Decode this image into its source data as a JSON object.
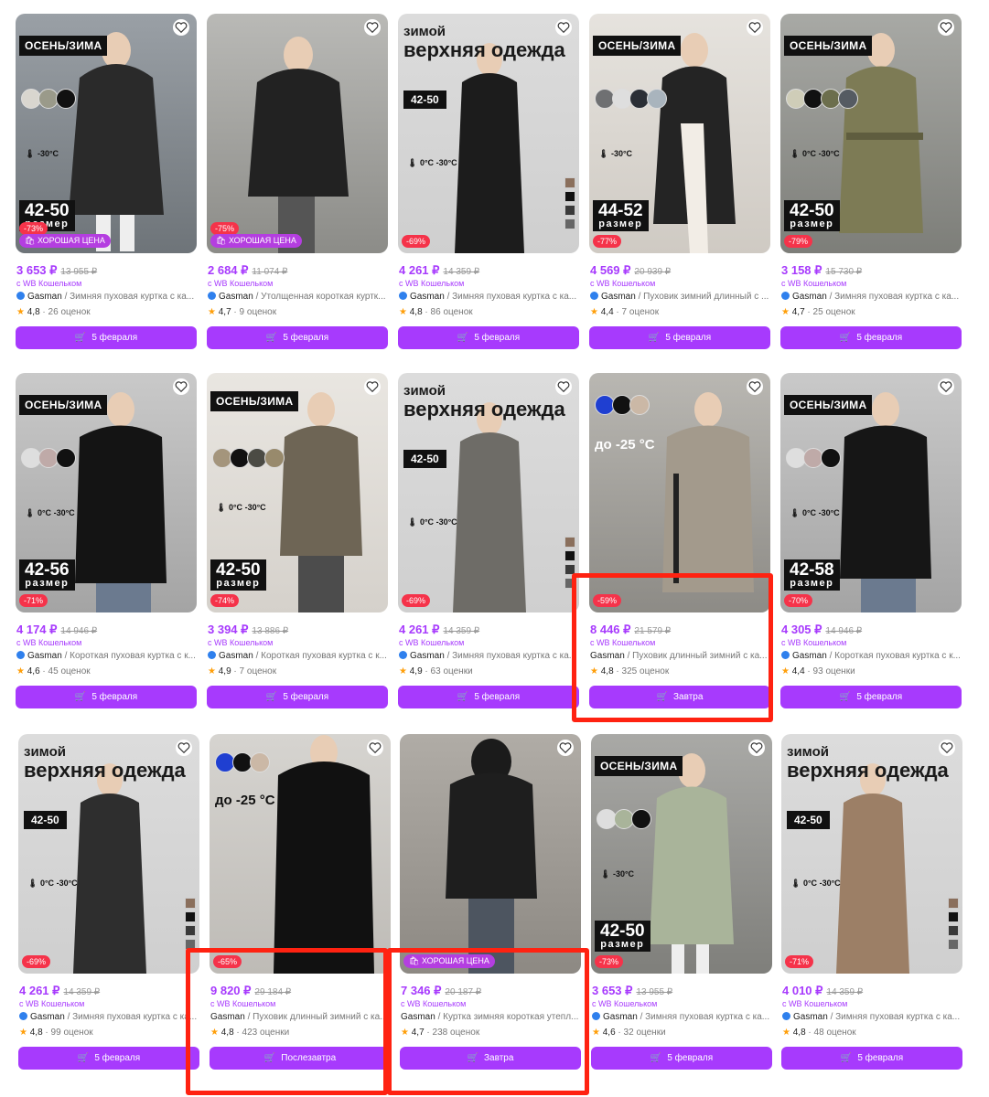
{
  "common": {
    "wallet": "с WB Кошельком",
    "razmer": "размер",
    "heat_plus": "0°C",
    "heat_minus": "-30°C",
    "headline1": "зимой",
    "headline2": "верхняя одежда"
  },
  "row1": [
    {
      "season": "ОСЕНЬ/ЗИМА",
      "size": "42-50",
      "discount": "-73%",
      "good": "ХОРОШАЯ ЦЕНА",
      "temp": "-30°C",
      "price": "3 653 ₽",
      "old": "13 955 ₽",
      "brand": "Gasman",
      "name": "Зимняя пуховая куртка с ка...",
      "rating": "4,8",
      "reviews": "26 оценок",
      "delivery": "5 февраля"
    },
    {
      "discount": "-75%",
      "good": "ХОРОШАЯ ЦЕНА",
      "price": "2 684 ₽",
      "old": "11 074 ₽",
      "brand": "Gasman",
      "name": "Утолщенная короткая куртк...",
      "rating": "4,7",
      "reviews": "9 оценок",
      "delivery": "5 февраля"
    },
    {
      "sizebox": "42-50",
      "discount": "-69%",
      "price": "4 261 ₽",
      "old": "14 359 ₽",
      "brand": "Gasman",
      "name": "Зимняя пуховая куртка с ка...",
      "rating": "4,8",
      "reviews": "86 оценок",
      "delivery": "5 февраля"
    },
    {
      "season": "ОСЕНЬ/ЗИМА",
      "size": "44-52",
      "discount": "-77%",
      "temp": "-30°C",
      "price": "4 569 ₽",
      "old": "20 939 ₽",
      "brand": "Gasman",
      "name": "Пуховик зимний длинный с ...",
      "rating": "4,4",
      "reviews": "7 оценок",
      "delivery": "5 февраля"
    },
    {
      "season": "ОСЕНЬ/ЗИМА",
      "size": "42-50",
      "discount": "-79%",
      "price": "3 158 ₽",
      "old": "15 730 ₽",
      "brand": "Gasman",
      "name": "Зимняя пуховая куртка с ка...",
      "rating": "4,7",
      "reviews": "25 оценок",
      "delivery": "5 февраля"
    }
  ],
  "row2": [
    {
      "season": "ОСЕНЬ/ЗИМА",
      "size": "42-56",
      "discount": "-71%",
      "price": "4 174 ₽",
      "old": "14 946 ₽",
      "brand": "Gasman",
      "name": "Короткая пуховая куртка с к...",
      "rating": "4,6",
      "reviews": "45 оценок",
      "delivery": "5 февраля"
    },
    {
      "season": "ОСЕНЬ/ЗИМА",
      "size": "42-50",
      "discount": "-74%",
      "price": "3 394 ₽",
      "old": "13 886 ₽",
      "brand": "Gasman",
      "name": "Короткая пуховая куртка с к...",
      "rating": "4,9",
      "reviews": "7 оценок",
      "delivery": "5 февраля"
    },
    {
      "sizebox": "42-50",
      "discount": "-69%",
      "price": "4 261 ₽",
      "old": "14 359 ₽",
      "brand": "Gasman",
      "name": "Зимняя пуховая куртка с ка...",
      "rating": "4,9",
      "reviews": "63 оценки",
      "delivery": "5 февраля"
    },
    {
      "tempc": "до -25 °C",
      "discount": "-59%",
      "price": "8 446 ₽",
      "old": "21 579 ₽",
      "brand": "Gasman",
      "name": "Пуховик длинный зимний с ка...",
      "rating": "4,8",
      "reviews": "325 оценок",
      "delivery": "Завтра"
    },
    {
      "season": "ОСЕНЬ/ЗИМА",
      "size": "42-58",
      "discount": "-70%",
      "price": "4 305 ₽",
      "old": "14 946 ₽",
      "brand": "Gasman",
      "name": "Короткая пуховая куртка с к...",
      "rating": "4,4",
      "reviews": "93 оценки",
      "delivery": "5 февраля"
    }
  ],
  "row3": [
    {
      "sizebox": "42-50",
      "discount": "-69%",
      "price": "4 261 ₽",
      "old": "14 359 ₽",
      "brand": "Gasman",
      "name": "Зимняя пуховая куртка с ка...",
      "rating": "4,8",
      "reviews": "99 оценок",
      "delivery": "5 февраля"
    },
    {
      "tempc": "до -25 °C",
      "discount": "-65%",
      "price": "9 820 ₽",
      "old": "29 184 ₽",
      "brand": "Gasman",
      "name": "Пуховик длинный зимний с ка...",
      "rating": "4,8",
      "reviews": "423 оценки",
      "delivery": "Послезавтра"
    },
    {
      "good": "ХОРОШАЯ ЦЕНА",
      "price": "7 346 ₽",
      "old": "20 187 ₽",
      "brand": "Gasman",
      "name": "Куртка зимняя короткая утепл...",
      "rating": "4,7",
      "reviews": "238 оценок",
      "delivery": "Завтра"
    },
    {
      "season": "ОСЕНЬ/ЗИМА",
      "size": "42-50",
      "discount": "-73%",
      "temp": "-30°C",
      "price": "3 653 ₽",
      "old": "13 955 ₽",
      "brand": "Gasman",
      "name": "Зимняя пуховая куртка с ка...",
      "rating": "4,6",
      "reviews": "32 оценки",
      "delivery": "5 февраля"
    },
    {
      "sizebox": "42-50",
      "discount": "-71%",
      "price": "4 010 ₽",
      "old": "14 359 ₽",
      "brand": "Gasman",
      "name": "Зимняя пуховая куртка с ка...",
      "rating": "4,8",
      "reviews": "48 оценок",
      "delivery": "5 февраля"
    }
  ],
  "colors": {
    "accent": "#a73afd",
    "discount": "#f5334a",
    "highlight": "#ff2211"
  }
}
